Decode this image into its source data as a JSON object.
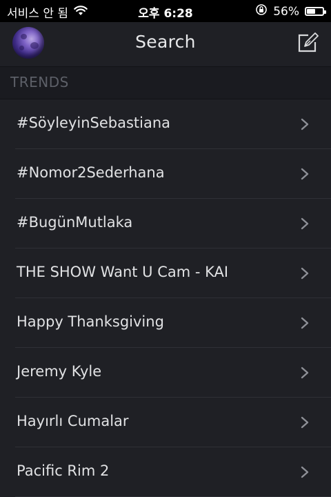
{
  "status_bar": {
    "carrier": "서비스 안 됨",
    "time": "오후 6:28",
    "battery_percent": "56%",
    "battery_level": 0.56,
    "icons": [
      "wifi-icon",
      "orientation-lock-icon",
      "battery-icon"
    ]
  },
  "nav": {
    "title": "Search",
    "avatar_icon": "moon-avatar",
    "compose_icon": "compose-icon"
  },
  "trends": {
    "header": "TRENDS",
    "items": [
      {
        "label": "#SöyleyinSebastiana"
      },
      {
        "label": "#Nomor2Sederhana"
      },
      {
        "label": "#BugünMutlaka"
      },
      {
        "label": "THE SHOW Want U Cam - KAI"
      },
      {
        "label": "Happy Thanksgiving"
      },
      {
        "label": "Jeremy Kyle"
      },
      {
        "label": "Hayırlı Cumalar"
      },
      {
        "label": "Pacific Rim 2"
      }
    ]
  },
  "colors": {
    "background": "#1f2025",
    "header_background": "#1a1b20",
    "text": "#e1e2e4",
    "header_text": "#5d6068",
    "chevron": "#8e9097",
    "separator": "#2f3036"
  }
}
